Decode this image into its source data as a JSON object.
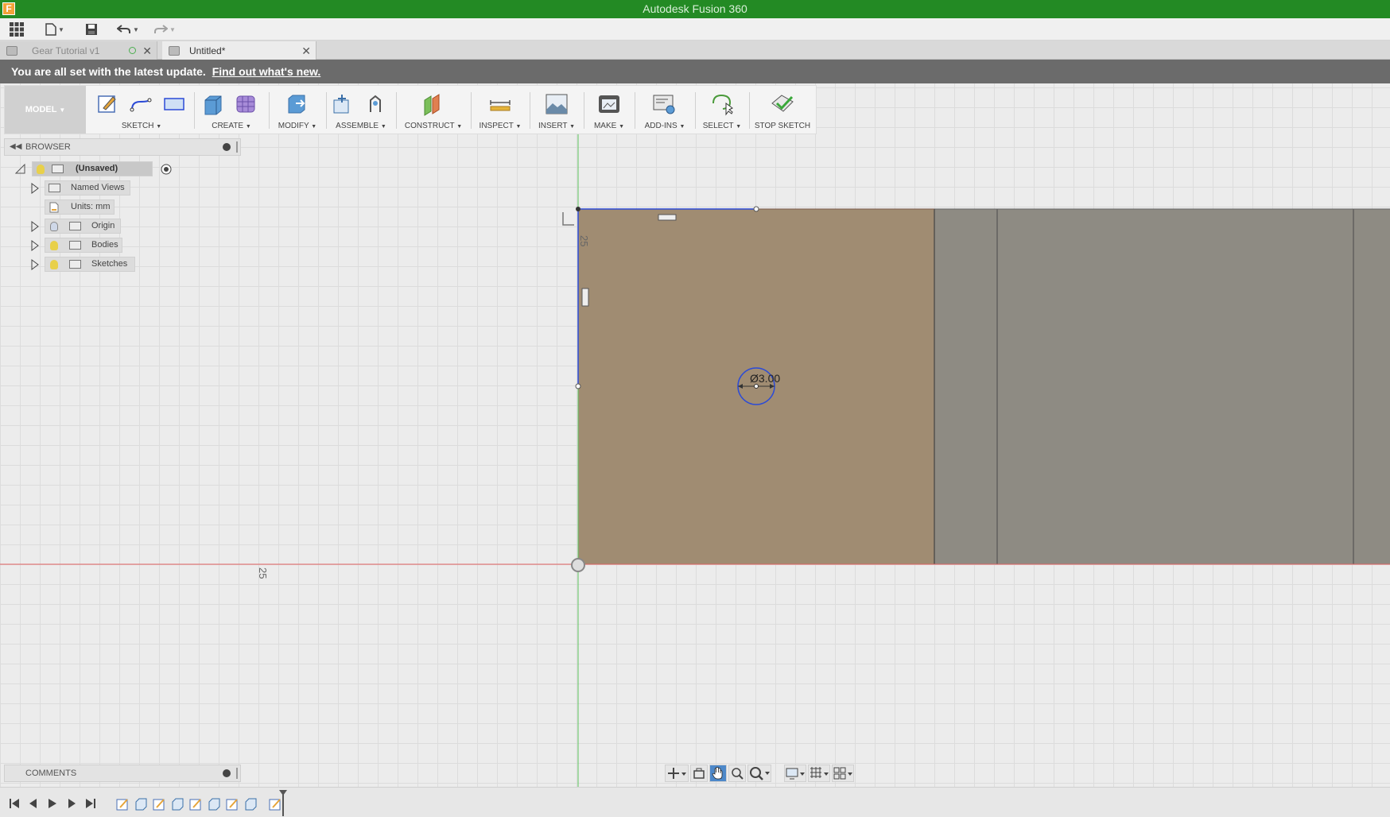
{
  "app": {
    "title": "Autodesk Fusion 360",
    "logo_letter": "F"
  },
  "tabs": [
    {
      "label": "Gear Tutorial v1",
      "active": false
    },
    {
      "label": "Untitled*",
      "active": true
    }
  ],
  "notice": {
    "text": "You are all set with the latest update.",
    "link": "Find out what's new."
  },
  "toolbar": {
    "workspace": "MODEL",
    "groups": {
      "sketch": "SKETCH",
      "create": "CREATE",
      "modify": "MODIFY",
      "assemble": "ASSEMBLE",
      "construct": "CONSTRUCT",
      "inspect": "INSPECT",
      "insert": "INSERT",
      "make": "MAKE",
      "addins": "ADD-INS",
      "select": "SELECT",
      "stop_sketch": "STOP SKETCH"
    }
  },
  "browser": {
    "title": "BROWSER",
    "root": "(Unsaved)",
    "items": [
      {
        "label": "Named Views"
      },
      {
        "label": "Units: mm"
      },
      {
        "label": "Origin"
      },
      {
        "label": "Bodies"
      },
      {
        "label": "Sketches"
      }
    ]
  },
  "canvas": {
    "dimension_diameter": "Ø3.00",
    "axis_label_vertical": "25",
    "axis_label_horizontal": "25"
  },
  "comments": {
    "title": "COMMENTS"
  },
  "colors": {
    "titlebar": "#238a24",
    "sketch_face": "#a08c72",
    "body_face": "#8e8b83",
    "sketch_line": "#2c4bd6",
    "x_axis": "#e06060",
    "y_axis": "#5cc45c"
  }
}
